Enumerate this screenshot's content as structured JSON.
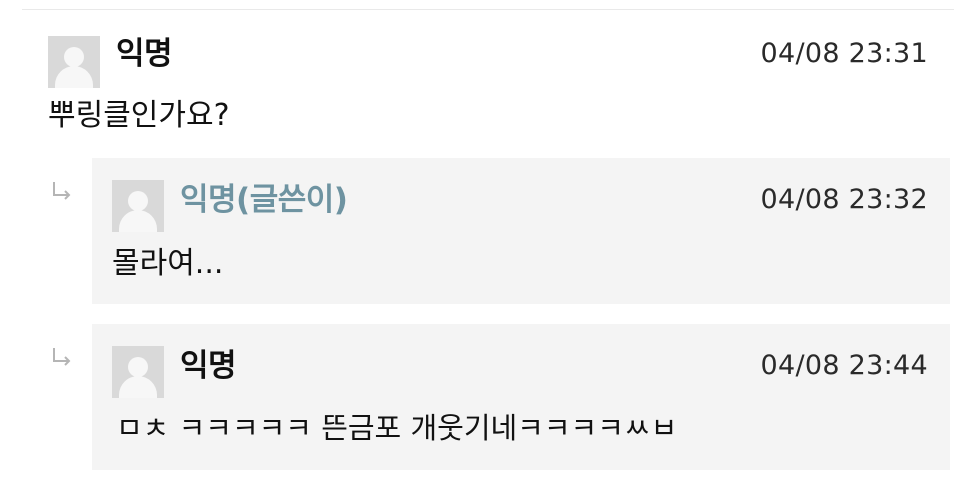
{
  "comments": [
    {
      "author": "익명",
      "time": "04/08 23:31",
      "text": "뿌링클인가요?"
    }
  ],
  "replies": [
    {
      "author": "익명(글쓴이)",
      "time": "04/08 23:32",
      "text": "몰라여...",
      "author_color": "#6e93a1"
    },
    {
      "author": "익명",
      "time": "04/08 23:44",
      "text": "ㅁㅊ ㅋㅋㅋㅋㅋ 뜬금포 개웃기네ㅋㅋㅋㅋㅆㅂ"
    }
  ],
  "icons": {
    "avatar": "default-user-avatar-icon",
    "reply": "reply-arrow-icon"
  }
}
